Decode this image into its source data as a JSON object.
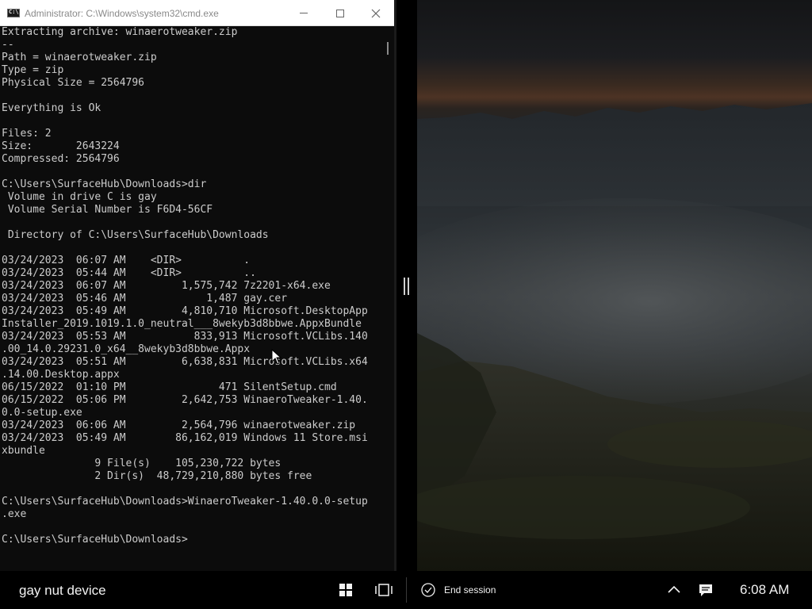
{
  "window": {
    "title": "Administrator: C:\\Windows\\system32\\cmd.exe",
    "app_icon": "cmd-icon",
    "icon_text": "C:\\"
  },
  "console": {
    "lines": [
      "Extracting archive: winaerotweaker.zip",
      "--",
      "Path = winaerotweaker.zip",
      "Type = zip",
      "Physical Size = 2564796",
      "",
      "Everything is Ok",
      "",
      "Files: 2",
      "Size:       2643224",
      "Compressed: 2564796",
      "",
      "C:\\Users\\SurfaceHub\\Downloads>dir",
      " Volume in drive C is gay",
      " Volume Serial Number is F6D4-56CF",
      "",
      " Directory of C:\\Users\\SurfaceHub\\Downloads",
      "",
      "03/24/2023  06:07 AM    <DIR>          .",
      "03/24/2023  05:44 AM    <DIR>          ..",
      "03/24/2023  06:07 AM         1,575,742 7z2201-x64.exe",
      "03/24/2023  05:46 AM             1,487 gay.cer",
      "03/24/2023  05:49 AM         4,810,710 Microsoft.DesktopApp",
      "Installer_2019.1019.1.0_neutral___8wekyb3d8bbwe.AppxBundle",
      "03/24/2023  05:53 AM           833,913 Microsoft.VCLibs.140",
      ".00_14.0.29231.0_x64__8wekyb3d8bbwe.Appx",
      "03/24/2023  05:51 AM         6,638,831 Microsoft.VCLibs.x64",
      ".14.00.Desktop.appx",
      "06/15/2022  01:10 PM               471 SilentSetup.cmd",
      "06/15/2022  05:06 PM         2,642,753 WinaeroTweaker-1.40.",
      "0.0-setup.exe",
      "03/24/2023  06:06 AM         2,564,796 winaerotweaker.zip",
      "03/24/2023  05:49 AM        86,162,019 Windows 11 Store.msi",
      "xbundle",
      "               9 File(s)    105,230,722 bytes",
      "               2 Dir(s)  48,729,210,880 bytes free",
      "",
      "C:\\Users\\SurfaceHub\\Downloads>WinaeroTweaker-1.40.0.0-setup",
      ".exe",
      "",
      "C:\\Users\\SurfaceHub\\Downloads>"
    ]
  },
  "taskbar": {
    "device_name": "gay nut device",
    "end_session_label": "End session",
    "clock": "6:08 AM",
    "icons": [
      "windows-start-icon",
      "task-view-icon",
      "checkmark-circle-icon",
      "chevron-up-icon",
      "notification-icon"
    ]
  }
}
